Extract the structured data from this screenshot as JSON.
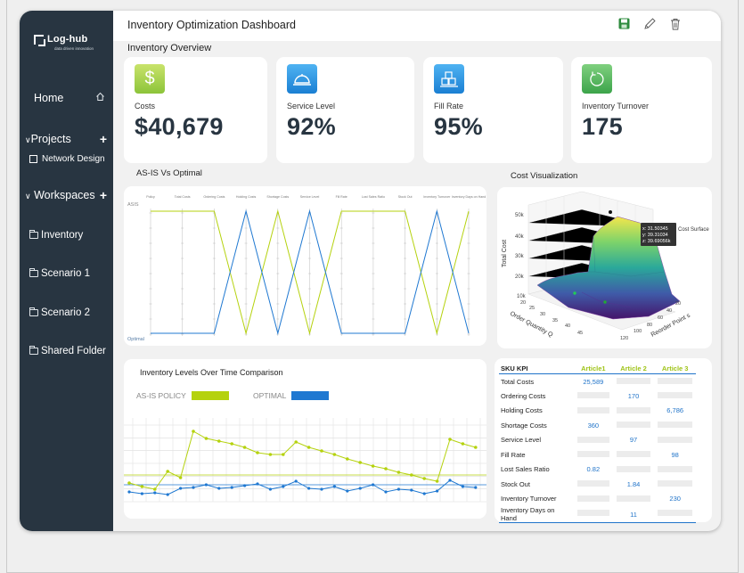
{
  "brand": {
    "name": "Log-hub",
    "tagline": "data driven innovation"
  },
  "sidebar": {
    "items": [
      {
        "label": "Home"
      },
      {
        "label": "Projects"
      },
      {
        "label": "Network Design"
      },
      {
        "label": "Workspaces"
      },
      {
        "label": "Inventory"
      },
      {
        "label": "Scenario 1"
      },
      {
        "label": "Scenario 2"
      },
      {
        "label": "Shared Folder"
      }
    ]
  },
  "header": {
    "title": "Inventory Optimization Dashboard"
  },
  "overview": {
    "title": "Inventory Overview",
    "cards": [
      {
        "label": "Costs",
        "value": "$40,679",
        "icon": "dollar-icon",
        "color": "#8dc63f"
      },
      {
        "label": "Service Level",
        "value": "92%",
        "icon": "service-bell-icon",
        "color": "#1f88d6"
      },
      {
        "label": "Fill Rate",
        "value": "95%",
        "icon": "boxes-icon",
        "color": "#1f88d6"
      },
      {
        "label": "Inventory Turnover",
        "value": "175",
        "icon": "refresh-icon",
        "color": "#4caf50"
      }
    ]
  },
  "asis": {
    "title": "AS-IS Vs Optimal",
    "label_top": "ASIS",
    "label_bottom": "Optimal",
    "dim_labels": [
      "Policy",
      "Total Costs",
      "Ordering Costs",
      "Holding Costs",
      "Shortage Costs",
      "Service Level",
      "Fill Rate",
      "Lost Sales Ratio",
      "Stock Out",
      "Inventory Turnover",
      "Inventory Days on Hand"
    ]
  },
  "cost_viz": {
    "title": "Cost Visualization",
    "zlabel": "Total Cost",
    "ylabel": "Order Quantity Q",
    "xlabel": "Reorder Point s",
    "z_ticks": [
      "50k",
      "40k",
      "30k",
      "20k",
      "10k"
    ],
    "q_ticks": [
      "20",
      "25",
      "30",
      "35",
      "40",
      "45"
    ],
    "s_ticks": [
      "20",
      "40",
      "60",
      "80",
      "100",
      "120"
    ],
    "tooltip": [
      "x: 31.50345",
      "y: 39.31034",
      "z: 39.69056k"
    ],
    "legend": "Cost Surface"
  },
  "timeline": {
    "title": "Inventory Levels Over Time Comparison",
    "legend": [
      {
        "name": "AS-IS POLICY",
        "color": "#b5d20e"
      },
      {
        "name": "OPTIMAL",
        "color": "#1f78d1"
      }
    ]
  },
  "sku": {
    "headers": [
      "SKU KPI",
      "Article1",
      "Article 2",
      "Article 3"
    ],
    "rows": [
      {
        "label": "Total Costs",
        "v": [
          "25,589",
          "",
          ""
        ]
      },
      {
        "label": "Ordering Costs",
        "v": [
          "",
          "170",
          ""
        ]
      },
      {
        "label": "Holding Costs",
        "v": [
          "",
          "",
          "6,786"
        ]
      },
      {
        "label": "Shortage Costs",
        "v": [
          "360",
          "",
          ""
        ]
      },
      {
        "label": "Service Level",
        "v": [
          "",
          "97",
          ""
        ]
      },
      {
        "label": "Fill Rate",
        "v": [
          "",
          "",
          "98"
        ]
      },
      {
        "label": "Lost Sales Ratio",
        "v": [
          "0.82",
          "",
          ""
        ]
      },
      {
        "label": "Stock Out",
        "v": [
          "",
          "1.84",
          ""
        ]
      },
      {
        "label": "Inventory Turnover",
        "v": [
          "",
          "",
          "230"
        ]
      },
      {
        "label": "Inventory Days on Hand",
        "v": [
          "",
          "11",
          ""
        ]
      }
    ]
  },
  "colors": {
    "sidebar": "#283541",
    "accent_green": "#b5d20e",
    "accent_blue": "#1f78d1"
  }
}
